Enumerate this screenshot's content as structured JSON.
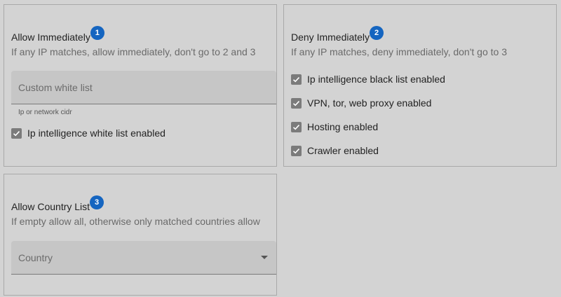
{
  "allow_immediately": {
    "title": "Allow Immediately",
    "badge": "1",
    "subtitle": "If any IP matches, allow immediately, don't go to 2 and 3",
    "custom_white_list": {
      "placeholder": "Custom white list",
      "value": "",
      "helper": "Ip or network cidr"
    },
    "checkboxes": [
      {
        "label": "Ip intelligence white list enabled",
        "checked": true
      }
    ]
  },
  "deny_immediately": {
    "title": "Deny Immediately",
    "badge": "2",
    "subtitle": "If any IP matches, deny immediately, don't go to 3",
    "checkboxes": [
      {
        "label": "Ip intelligence black list enabled",
        "checked": true
      },
      {
        "label": "VPN, tor, web proxy enabled",
        "checked": true
      },
      {
        "label": "Hosting enabled",
        "checked": true
      },
      {
        "label": "Crawler enabled",
        "checked": true
      }
    ]
  },
  "allow_country_list": {
    "title": "Allow Country List",
    "badge": "3",
    "subtitle": "If empty allow all, otherwise only matched countries allow",
    "country_select": {
      "placeholder": "Country",
      "icon": "chevron-down-icon"
    }
  },
  "colors": {
    "background": "#d3d3d3",
    "badge": "#1565c0",
    "checkbox": "#7b7b7b",
    "field": "#c6c6c6"
  }
}
